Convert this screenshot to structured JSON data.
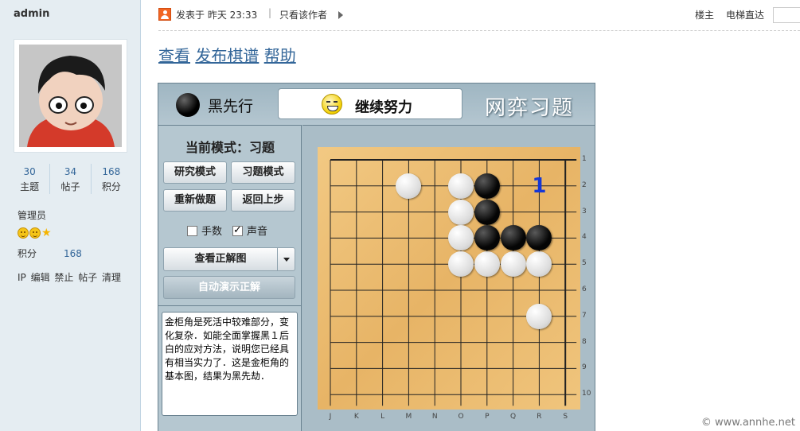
{
  "sidebar": {
    "username": "admin",
    "stats": [
      {
        "num": "30",
        "label": "主题"
      },
      {
        "num": "34",
        "label": "帖子"
      },
      {
        "num": "168",
        "label": "积分"
      }
    ],
    "role": "管理员",
    "points_label": "积分",
    "points_value": "168",
    "admin_links": "IP 编辑 禁止 帖子 清理"
  },
  "topbar": {
    "posted": "发表于 昨天 23:33",
    "separator": "|",
    "only_author": "只看该作者",
    "floor_label": "楼主",
    "elevator_label": "电梯直达"
  },
  "links": [
    "查看",
    "发布棋谱",
    "帮助"
  ],
  "widget": {
    "to_play": "黑先行",
    "message": "继续努力",
    "brand": "网弈习题",
    "mode": "当前模式：习题",
    "buttons": [
      "研究模式",
      "习题模式",
      "重新做题",
      "返回上步"
    ],
    "checkbox_moves": "手数",
    "checkbox_sound": "声音",
    "view_answer": "查看正解图",
    "auto_demo": "自动演示正解",
    "description": "金柜角是死活中较难部分，变化复杂．如能全面掌握黑１后白的应对方法，说明您已经具有相当实力了．这是金柜角的基本图，结果为黑先劫．",
    "board": {
      "columns": [
        "J",
        "K",
        "L",
        "M",
        "N",
        "O",
        "P",
        "Q",
        "R",
        "S"
      ],
      "rows": [
        "1",
        "2",
        "3",
        "4",
        "5",
        "6",
        "7",
        "8",
        "9",
        "10"
      ],
      "black": [
        [
          2,
          6
        ],
        [
          3,
          6
        ],
        [
          4,
          6
        ],
        [
          4,
          7
        ],
        [
          4,
          8
        ]
      ],
      "white": [
        [
          2,
          3
        ],
        [
          2,
          5
        ],
        [
          3,
          5
        ],
        [
          4,
          5
        ],
        [
          5,
          5
        ],
        [
          5,
          6
        ],
        [
          5,
          7
        ],
        [
          5,
          8
        ],
        [
          7,
          8
        ]
      ],
      "marks": [
        {
          "row": 2,
          "col": 8,
          "text": "1"
        }
      ]
    }
  },
  "copyright": "© www.annhe.net",
  "colors": {
    "link": "#336699",
    "sidebar_bg": "#e5edf2",
    "widget_bg": "#a8bcc6",
    "mark": "#1537d6"
  }
}
